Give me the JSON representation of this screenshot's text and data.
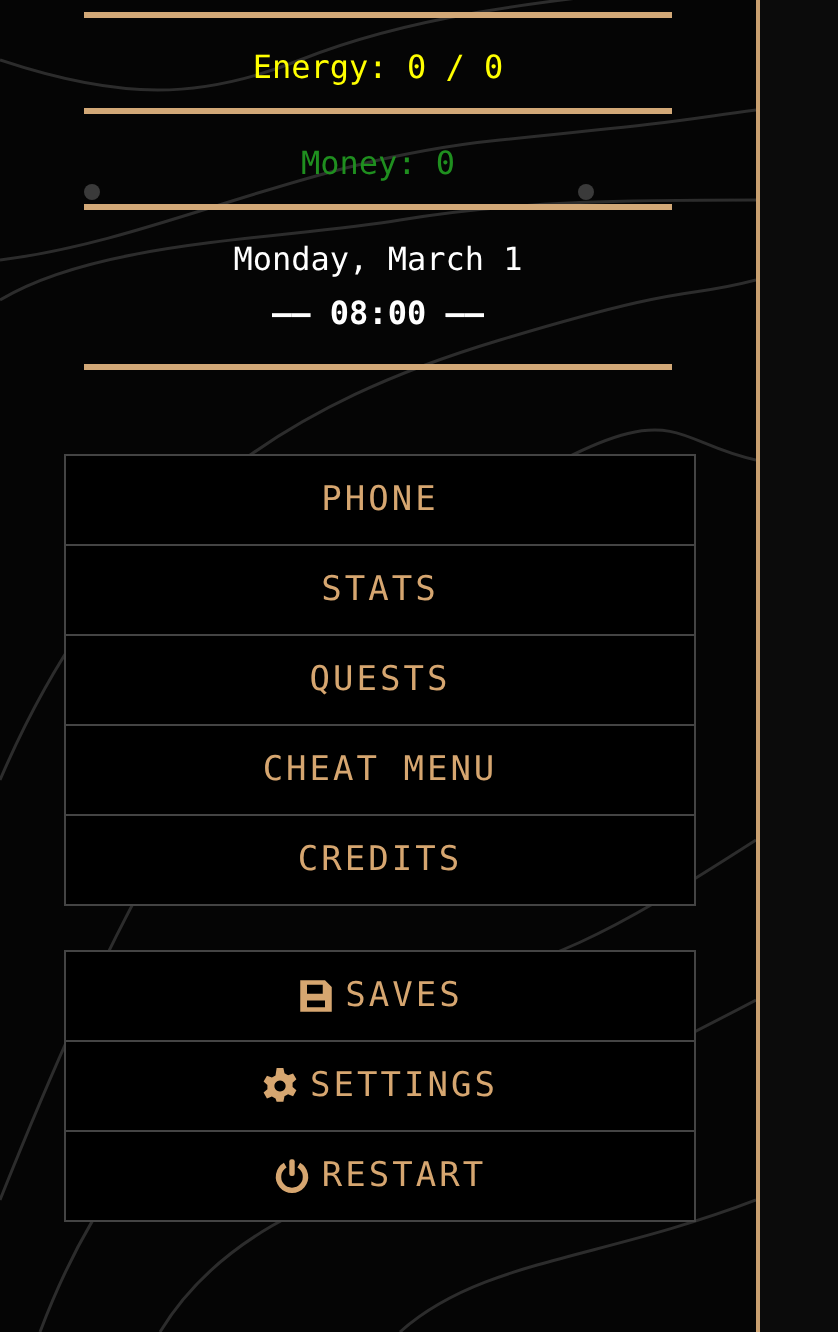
{
  "stats": {
    "energy": "Energy: 0 / 0",
    "money": "Money: 0",
    "date": "Monday, March 1",
    "time": "—— 08:00 ——"
  },
  "menu": [
    {
      "label": "PHONE",
      "kind": "plain"
    },
    {
      "label": "STATS",
      "kind": "plain"
    },
    {
      "label": "QUESTS",
      "kind": "plain"
    },
    {
      "label": "CHEAT MENU",
      "kind": "plain"
    },
    {
      "label": "CREDITS",
      "kind": "plain"
    }
  ],
  "system_menu": [
    {
      "label": "SAVES",
      "kind": "save"
    },
    {
      "label": "SETTINGS",
      "kind": "settings"
    },
    {
      "label": "RESTART",
      "kind": "restart"
    }
  ]
}
